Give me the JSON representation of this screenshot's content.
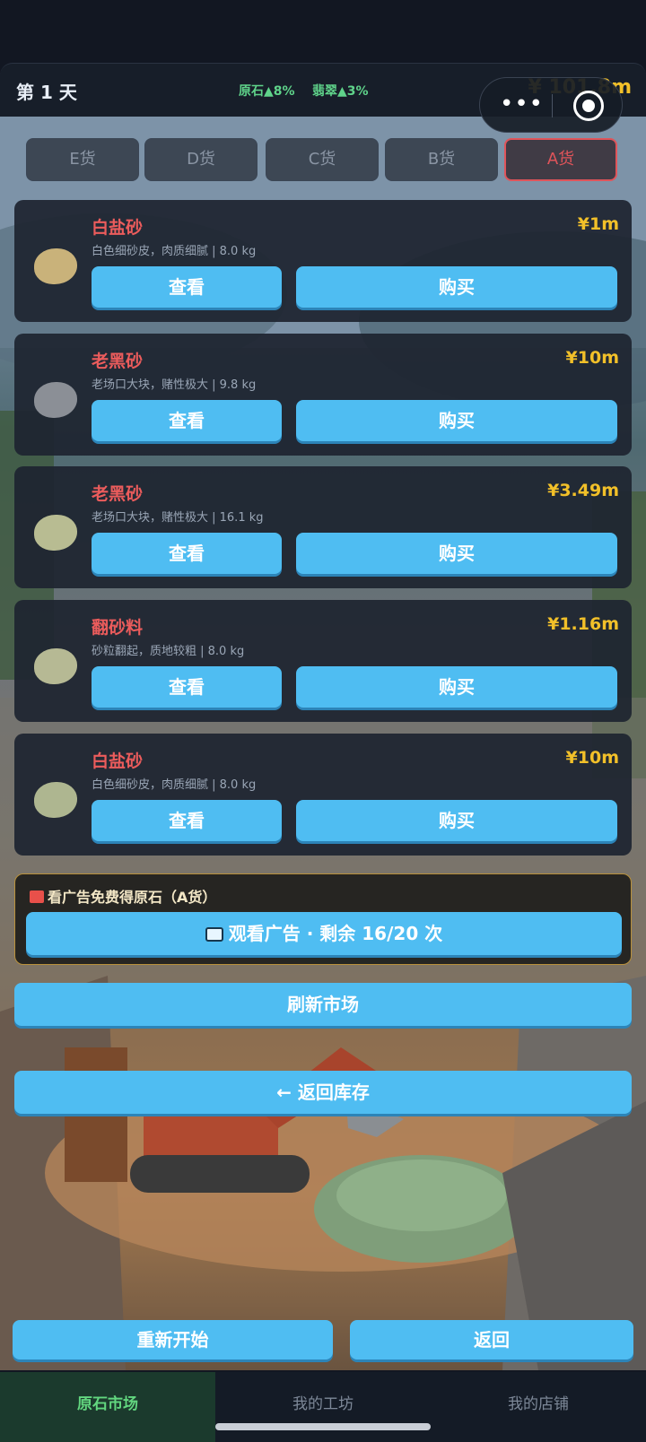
{
  "header": {
    "day": "第 1 天",
    "trend_stone": "原石▲8%",
    "trend_jade": "翡翠▲3%",
    "money": "¥ 101.8m"
  },
  "tabs": [
    "E货",
    "D货",
    "C货",
    "B货",
    "A货"
  ],
  "active_tab": "A货",
  "stones": [
    {
      "name": "白盐砂",
      "price": "¥1m",
      "desc": "白色细砂皮，肉质细腻 | 8.0 kg",
      "color": "#c9b27a"
    },
    {
      "name": "老黑砂",
      "price": "¥10m",
      "desc": "老场口大块，赌性极大 | 9.8 kg",
      "color": "#8b8f96"
    },
    {
      "name": "老黑砂",
      "price": "¥3.49m",
      "desc": "老场口大块，赌性极大 | 16.1 kg",
      "color": "#b8bc92"
    },
    {
      "name": "翻砂料",
      "price": "¥1.16m",
      "desc": "砂粒翻起，质地较粗 | 8.0 kg",
      "color": "#b6b994"
    },
    {
      "name": "白盐砂",
      "price": "¥10m",
      "desc": "白色细砂皮，肉质细腻 | 8.0 kg",
      "color": "#aeb690"
    }
  ],
  "view_label": "查看",
  "buy_label": "购买",
  "ad": {
    "title": "看广告免费得原石（A货）",
    "button": "观看广告 · 剩余 16/20 次"
  },
  "refresh_label": "刷新市场",
  "back_inventory_label": "← 返回库存",
  "restart_label": "重新开始",
  "back_label": "返回",
  "nav": [
    "原石市场",
    "我的工坊",
    "我的店铺"
  ],
  "colors": {
    "accent_blue": "#4fbdf2",
    "price_gold": "#f2c029",
    "name_red": "#ec5c5c",
    "trend_green": "#5fd38a"
  }
}
